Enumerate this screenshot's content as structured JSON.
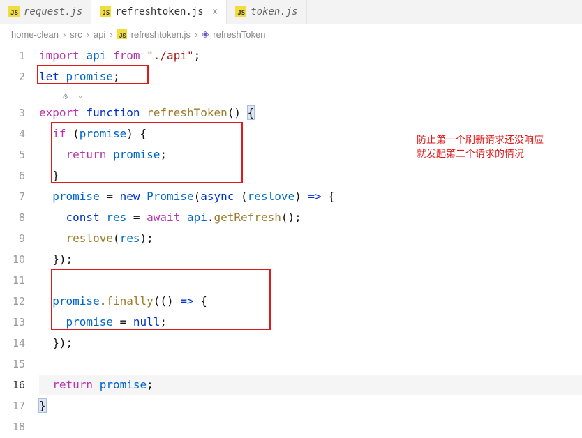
{
  "tabs": [
    {
      "label": "request.js",
      "active": false
    },
    {
      "label": "refreshtoken.js",
      "active": true
    },
    {
      "label": "token.js",
      "active": false
    }
  ],
  "breadcrumb": {
    "seg1": "home-clean",
    "seg2": "src",
    "seg3": "api",
    "seg4": "refreshtoken.js",
    "seg5": "refreshToken"
  },
  "lines": {
    "l1": "1",
    "l2": "2",
    "l3": "3",
    "l4": "4",
    "l5": "5",
    "l6": "6",
    "l7": "7",
    "l8": "8",
    "l9": "9",
    "l10": "10",
    "l11": "11",
    "l12": "12",
    "l13": "13",
    "l14": "14",
    "l15": "15",
    "l16": "16",
    "l17": "17",
    "l18": "18"
  },
  "code": {
    "l1_import": "import",
    "l1_api": "api",
    "l1_from": "from",
    "l1_path": "\"./api\"",
    "l1_semi": ";",
    "l2_let": "let",
    "l2_promise": "promise",
    "l2_semi": ";",
    "l3_export": "export",
    "l3_function": "function",
    "l3_name": "refreshToken",
    "l3_paren": "()",
    "l3_brace": "{",
    "l4_if": "if",
    "l4_open": " (",
    "l4_promise": "promise",
    "l4_close": ") {",
    "l5_return": "return",
    "l5_promise": "promise",
    "l5_semi": ";",
    "l6_close": "}",
    "l7_promise": "promise",
    "l7_eq": " = ",
    "l7_new": "new",
    "l7_Promise": "Promise",
    "l7_open": "(",
    "l7_async": "async",
    "l7_paren_res": " (",
    "l7_reslove": "reslove",
    "l7_close_res": ") ",
    "l7_arrow": "=>",
    "l7_brace": " {",
    "l8_const": "const",
    "l8_res": "res",
    "l8_eq": " = ",
    "l8_await": "await",
    "l8_api": "api",
    "l8_dot": ".",
    "l8_getRefresh": "getRefresh",
    "l8_call": "();",
    "l9_reslove": "reslove",
    "l9_open": "(",
    "l9_res": "res",
    "l9_close": ");",
    "l10_close": "});",
    "l12_promise": "promise",
    "l12_dot": ".",
    "l12_finally": "finally",
    "l12_open": "((",
    "l12_paren2": ") ",
    "l12_arrow": "=>",
    "l12_brace": " {",
    "l13_promise": "promise",
    "l13_eq": " = ",
    "l13_null": "null",
    "l13_semi": ";",
    "l14_close": "});",
    "l16_return": "return",
    "l16_promise": "promise",
    "l16_semi": ";",
    "l17_close": "}"
  },
  "annotation": {
    "line1": "防止第一个刷新请求还没响应",
    "line2": "就发起第二个请求的情况"
  }
}
